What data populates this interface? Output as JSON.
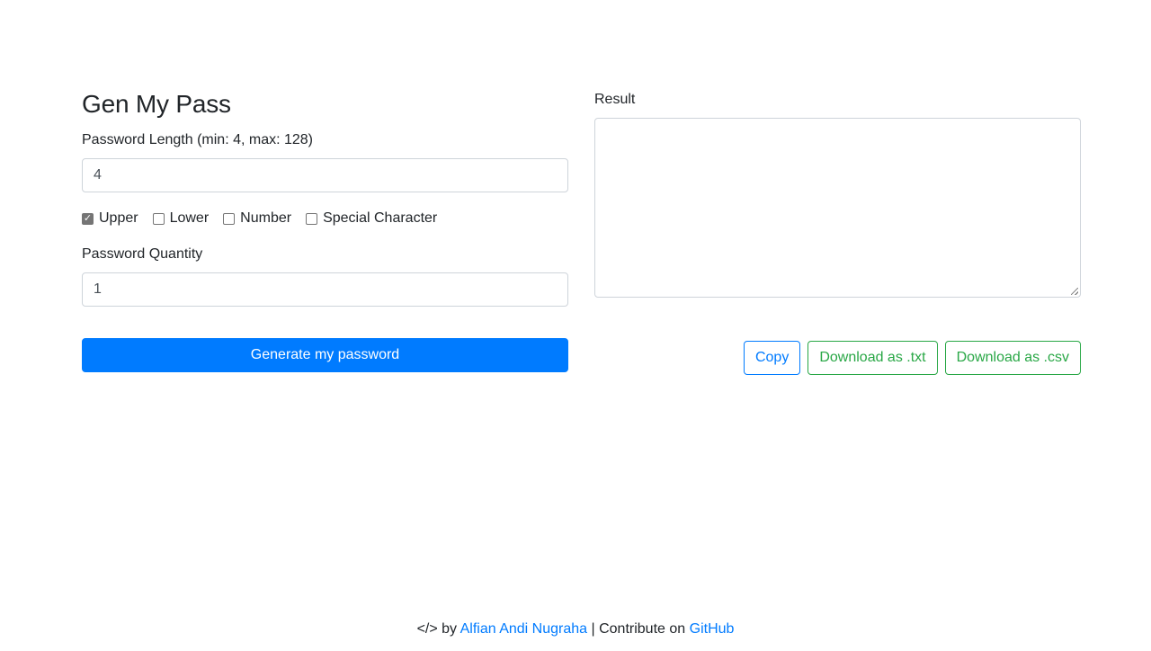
{
  "app": {
    "title": "Gen My Pass"
  },
  "form": {
    "length_label": "Password Length (min: 4, max: 128)",
    "length_value": "4",
    "options": [
      {
        "label": "Upper",
        "checked": true
      },
      {
        "label": "Lower",
        "checked": false
      },
      {
        "label": "Number",
        "checked": false
      },
      {
        "label": "Special Character",
        "checked": false
      }
    ],
    "quantity_label": "Password Quantity",
    "quantity_value": "1",
    "generate_label": "Generate my password"
  },
  "result": {
    "label": "Result",
    "value": "",
    "copy_label": "Copy",
    "download_txt_label": "Download as .txt",
    "download_csv_label": "Download as .csv"
  },
  "footer": {
    "prefix": "</> by",
    "author_link": "Alfian Andi Nugraha",
    "separator": "| Contribute on",
    "github_link": "GitHub"
  },
  "colors": {
    "primary": "#007bff",
    "success": "#28a745",
    "text": "#212529",
    "border": "#ced4da"
  }
}
